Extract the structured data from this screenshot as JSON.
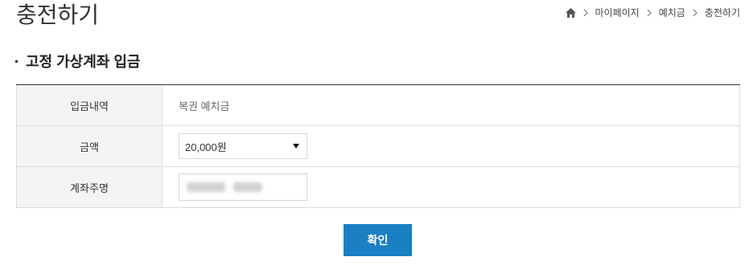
{
  "page": {
    "title": "충전하기"
  },
  "breadcrumb": {
    "icon": "home-icon",
    "items": [
      "마이페이지",
      "예치금",
      "충전하기"
    ]
  },
  "section": {
    "title": "고정 가상계좌 입금"
  },
  "form": {
    "rows": [
      {
        "label": "입금내역",
        "value": "복권 예치금"
      },
      {
        "label": "금액",
        "selected_value": "20,000원"
      },
      {
        "label": "계좌주명",
        "value_redacted": true
      }
    ]
  },
  "actions": {
    "confirm_label": "확인"
  },
  "colors": {
    "accent": "#1b7fc4",
    "label_bg": "#f4f4f4",
    "border": "#dcdcdc"
  }
}
